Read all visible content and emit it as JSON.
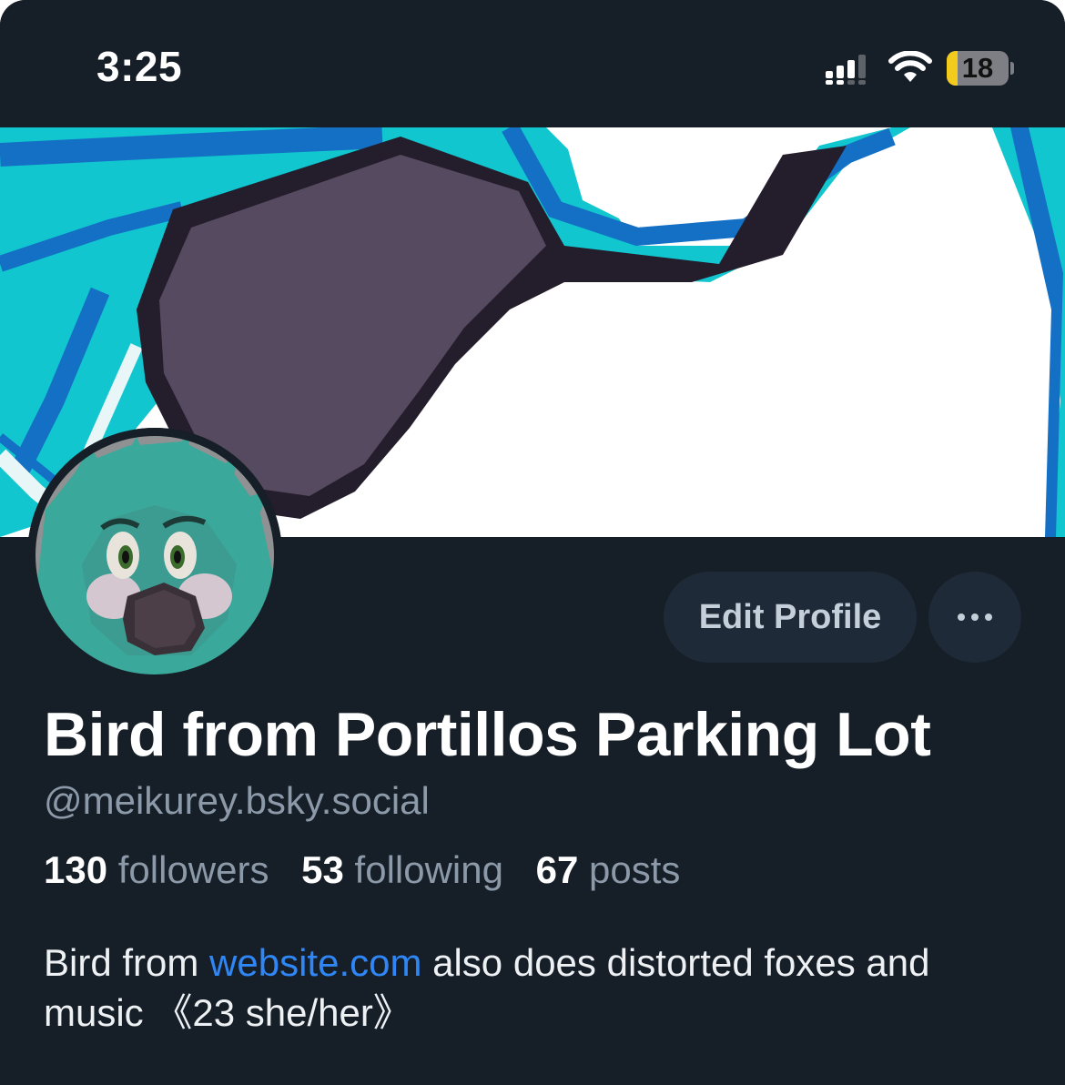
{
  "status_bar": {
    "time": "3:25",
    "battery_level": "18",
    "battery_fraction": 0.18,
    "icons": [
      "signal-icon",
      "wifi-icon",
      "battery-icon"
    ]
  },
  "profile": {
    "display_name": "Bird from Portillos Parking Lot",
    "handle": "@meikurey.bsky.social",
    "edit_profile_label": "Edit Profile",
    "more_icon": "ellipsis-icon",
    "stats": {
      "followers_count": "130",
      "followers_label": "followers",
      "following_count": "53",
      "following_label": "following",
      "posts_count": "67",
      "posts_label": "posts"
    },
    "bio": {
      "before_link": "Bird from ",
      "link_text": "website.com",
      "after_link": " also does distorted foxes and music 《23 she/her》"
    }
  },
  "colors": {
    "background": "#161e27",
    "button_bg": "#1e2a37",
    "link": "#2f86f5",
    "muted_text": "#8c99a8",
    "banner_teal": "#11c6cf",
    "banner_blue": "#1470c4",
    "battery_yellow": "#f2cb1d"
  }
}
